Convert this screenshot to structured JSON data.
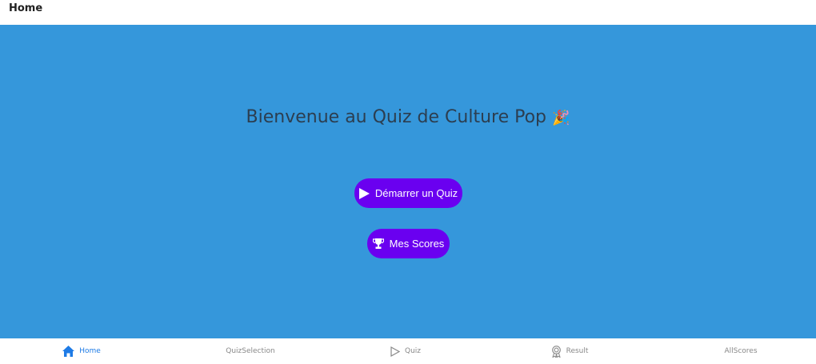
{
  "header": {
    "title": "Home"
  },
  "main": {
    "welcome_text": "Bienvenue au Quiz de Culture Pop",
    "welcome_emoji": "🎉",
    "start_button": {
      "label": "Démarrer un Quiz",
      "icon": "play-icon"
    },
    "scores_button": {
      "label": "Mes Scores",
      "icon": "trophy-icon"
    }
  },
  "tabbar": {
    "items": [
      {
        "label": "Home",
        "icon": "home-icon",
        "active": true
      },
      {
        "label": "QuizSelection",
        "icon": "",
        "active": false
      },
      {
        "label": "Quiz",
        "icon": "play-outline-icon",
        "active": false
      },
      {
        "label": "Result",
        "icon": "award-icon",
        "active": false
      },
      {
        "label": "AllScores",
        "icon": "",
        "active": false
      }
    ]
  },
  "colors": {
    "background": "#3597db",
    "button": "#6a00f0",
    "active_tab": "#1e7be6"
  }
}
